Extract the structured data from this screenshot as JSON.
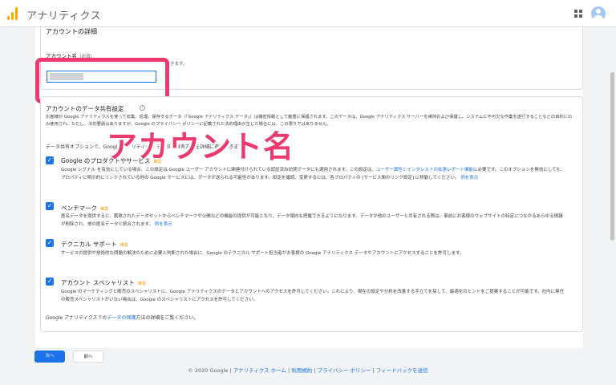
{
  "app": {
    "title": "アナリティクス"
  },
  "account": {
    "section_title": "アカウントの詳細",
    "name_label": "アカウント名",
    "required": "（必須）",
    "name_hint": "きます。"
  },
  "sharing": {
    "title": "アカウントのデータ共有設定",
    "help": "?",
    "description": "お客様が Google アナリティクスを使って収集、処理、保存するデータ（「Google アナリティクス データ」）は機密情報として厳重に保護されます。このデータは、Google アナリティクス サーバーを維持および保護し、システムに不可欠な作業を遂行することなどの目的にのみ使用され、ただし、法的要請はありますが、Google のプライバシー ポリシーに記載された法的理由が生じた場合には、この限りではありません。",
    "options_intro": "データ共有オプションで、Google アナリティクス データの共有方法を詳細に管理できます。詳細"
  },
  "overlay_label": "アカウント名",
  "options": [
    {
      "title": "Google のプロダクトやサービス",
      "tag": "推奨",
      "desc_a": "Google シグナル を有効にしている場合、この設定は Google ユーザー アカウントに関連付けられている認証済み訪問データにも適用されます。この設定は、",
      "desc_link": "ユーザー属性とインタレストの拡張レポート機能",
      "desc_b": "に必要です。このオプションを無効にしても、プロパティに明示的にリンクされている他の Google サービスには、データが送られる可能性があります。設定を確認、変更するには、各プロパティの [サービス間のリンク設定] に移動してください。",
      "example": "例を表示"
    },
    {
      "title": "ベンチマーク",
      "tag": "推奨",
      "desc_a": "匿名データを提供すると、蓄積されたデータセットからベンチマークや公開などの機能の提供が可能となり、データ傾向も把握できるようになります。データが他のユーザーと共有される際は、事前にお客様のウェブサイトの特定につながるあらゆる情報が削除され、他の匿名データと統合されます。",
      "example": "例を表示"
    },
    {
      "title": "テクニカル サポート",
      "tag": "推奨",
      "desc_a": "サービスの提供や技術的な問題の解決のために必要と判断された場合に、Google のテクニカル サポート担当者がお客様の Google アナリティクス データやアカウントにアクセスすることを許可します。"
    },
    {
      "title": "アカウント スペシャリスト",
      "tag": "推奨",
      "desc_a": "Google のマーケティングと販売のスペシャリストに、Google アナリティクスのデータとアカウントへのアクセスを許可してください。これにより、現在の設定や分析を改善する手立てを探して、最適化のヒントをご提案することが可能です。社内に専任の販売スペシャリストがいない場合は、Google のスペシャリストにアクセスを許可してください。"
    }
  ],
  "footnote": {
    "a": "Google アナリティクスでの",
    "link": "データの保護",
    "b": "方法の詳細をご覧ください。"
  },
  "buttons": {
    "next": "次へ",
    "prev": "前へ"
  },
  "footer": {
    "copyright": "© 2020 Google",
    "links": [
      "アナリティクス ホーム",
      "利用規約",
      "プライバシー ポリシー",
      "フィードバックを送信"
    ]
  },
  "colors": {
    "accent": "#1a73e8",
    "highlight": "#ec3a6e",
    "logo": "#f9ab00"
  }
}
